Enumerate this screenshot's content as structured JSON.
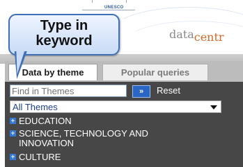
{
  "header": {
    "unesco_label": "UNESCO",
    "logo_text_main": "data",
    "logo_text_accent": "centr"
  },
  "callout": {
    "line1": "Type in",
    "line2": "keyword"
  },
  "tabs": [
    {
      "label": "Data by theme",
      "active": true
    },
    {
      "label": "Popular queries",
      "active": false
    }
  ],
  "search": {
    "placeholder": "Find in Themes",
    "value": "",
    "go_label": "»",
    "reset_label": "Reset"
  },
  "theme_select": {
    "selected": "All Themes"
  },
  "theme_tree": [
    {
      "label": "EDUCATION"
    },
    {
      "label": "SCIENCE, TECHNOLOGY AND INNOVATION"
    },
    {
      "label": "CULTURE"
    }
  ],
  "colors": {
    "panel_bg": "#474747",
    "accent_blue": "#2a66c4",
    "callout_border": "#3f6fb5"
  }
}
